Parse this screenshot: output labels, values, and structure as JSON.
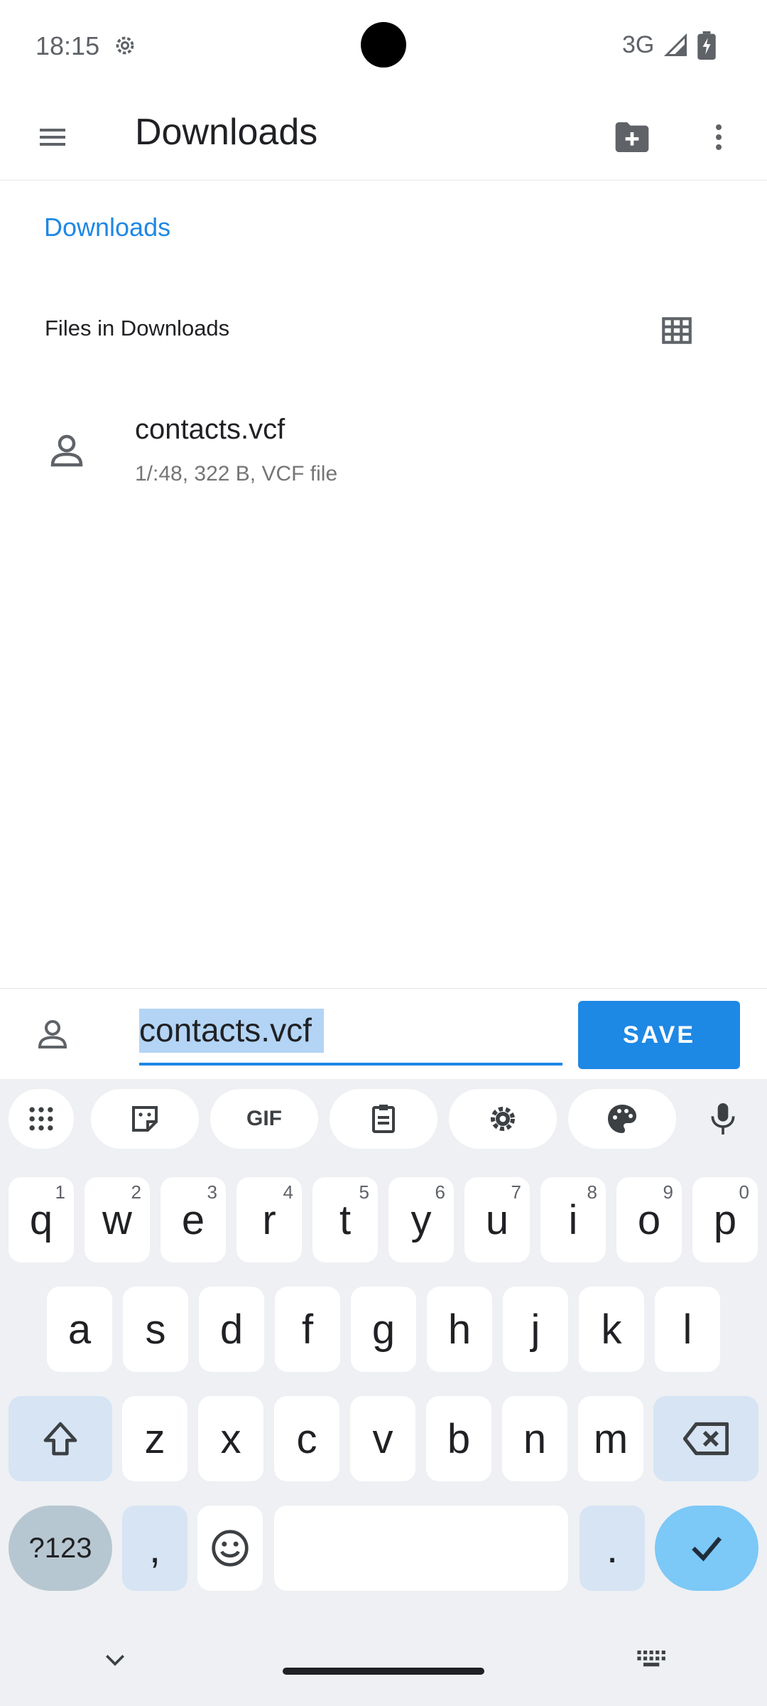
{
  "status_bar": {
    "time": "18:15",
    "network": "3G",
    "icons": [
      "settings-icon",
      "signal-icon",
      "battery-icon"
    ]
  },
  "app_bar": {
    "title": "Downloads",
    "icons": [
      "menu-icon",
      "new-folder-icon",
      "more-vert-icon"
    ]
  },
  "breadcrumb": {
    "items": [
      {
        "label": "Downloads"
      }
    ]
  },
  "section": {
    "title": "Files in Downloads",
    "view_icon": "grid-view-icon"
  },
  "files": [
    {
      "name": "contacts.vcf",
      "meta": "1/:48, 322 B, VCF file",
      "icon": "contact-file-icon"
    }
  ],
  "save_bar": {
    "filename": "contacts.vcf",
    "save_label": "SAVE",
    "icon": "contact-file-icon"
  },
  "keyboard": {
    "toolbar": [
      {
        "name": "apps-icon",
        "label": ""
      },
      {
        "name": "sticker-icon",
        "label": ""
      },
      {
        "name": "gif-button",
        "label": "GIF"
      },
      {
        "name": "clipboard-icon",
        "label": ""
      },
      {
        "name": "settings-icon",
        "label": ""
      },
      {
        "name": "theme-icon",
        "label": ""
      },
      {
        "name": "mic-icon",
        "label": ""
      }
    ],
    "row1": [
      {
        "k": "q",
        "h": "1"
      },
      {
        "k": "w",
        "h": "2"
      },
      {
        "k": "e",
        "h": "3"
      },
      {
        "k": "r",
        "h": "4"
      },
      {
        "k": "t",
        "h": "5"
      },
      {
        "k": "y",
        "h": "6"
      },
      {
        "k": "u",
        "h": "7"
      },
      {
        "k": "i",
        "h": "8"
      },
      {
        "k": "o",
        "h": "9"
      },
      {
        "k": "p",
        "h": "0"
      }
    ],
    "row2": [
      "a",
      "s",
      "d",
      "f",
      "g",
      "h",
      "j",
      "k",
      "l"
    ],
    "row3": [
      "z",
      "x",
      "c",
      "v",
      "b",
      "n",
      "m"
    ],
    "symbols_label": "?123",
    "comma": ",",
    "period": "."
  },
  "colors": {
    "accent": "#1e88e5",
    "keyboard_bg": "#eef0f3",
    "function_key": "#d6e4f4",
    "enter_key": "#7cc8f7"
  }
}
